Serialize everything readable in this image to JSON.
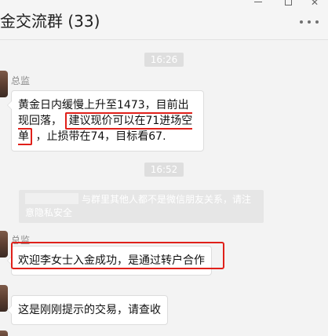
{
  "window": {
    "title": "金交流群 (33)",
    "more_button": "..."
  },
  "chat": {
    "messages": [
      {
        "time": "16:26",
        "sender": "总监",
        "text_before": "黄金日内缓慢上升至1473，目前出现回落，",
        "text_highlight": "建议现价可以在71进场空单",
        "text_after": "，止损带在74，目标看67."
      },
      {
        "time": "16:52",
        "system_notice": "与群里其他人都不是微信朋友关系，请注意隐私安全"
      },
      {
        "sender": "总监",
        "text": "欢迎李女士入金成功，是通过转户合作"
      },
      {
        "sender": "",
        "text": "这是刚刚提示的交易，请查收"
      }
    ]
  }
}
